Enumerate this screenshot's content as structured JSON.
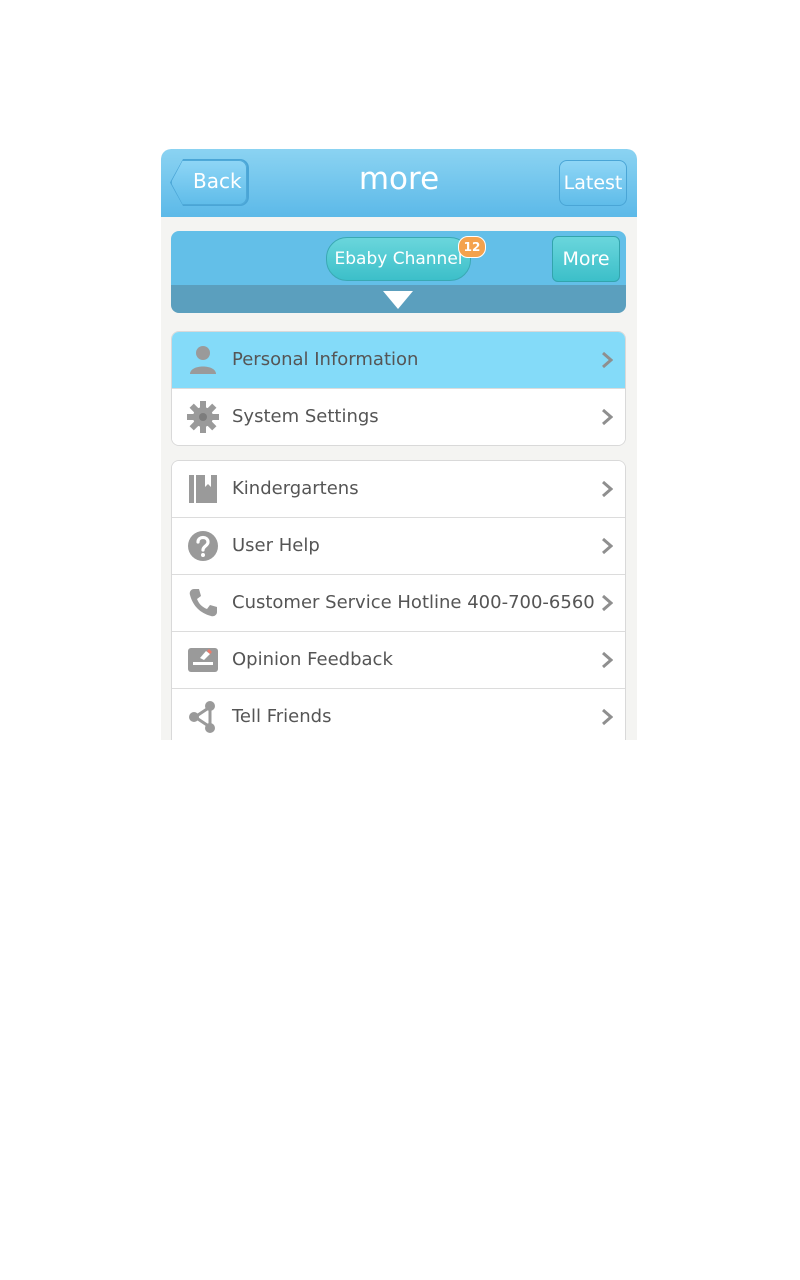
{
  "nav": {
    "back_label": "Back",
    "title": "more",
    "latest_label": "Latest"
  },
  "channel": {
    "tab_label": "Ebaby Channel",
    "badge_count": "12",
    "more_label": "More"
  },
  "groups": [
    {
      "items": [
        {
          "label": "Personal Information",
          "icon": "user-icon",
          "active": true
        },
        {
          "label": "System Settings",
          "icon": "gear-icon",
          "active": false
        }
      ]
    },
    {
      "items": [
        {
          "label": "Kindergartens",
          "icon": "bookmark-book-icon"
        },
        {
          "label": "User Help",
          "icon": "question-icon"
        },
        {
          "label": "Customer Service Hotline 400-700-6560",
          "icon": "phone-icon"
        },
        {
          "label": "Opinion Feedback",
          "icon": "feedback-box-icon"
        },
        {
          "label": "Tell Friends",
          "icon": "share-icon"
        }
      ]
    }
  ],
  "colors": {
    "nav_blue": "#5cb9e8",
    "active_row": "#84dbf9",
    "teal_button": "#3cbfc9",
    "badge": "#f4a24d",
    "icon_gray": "#9a9a9a"
  }
}
